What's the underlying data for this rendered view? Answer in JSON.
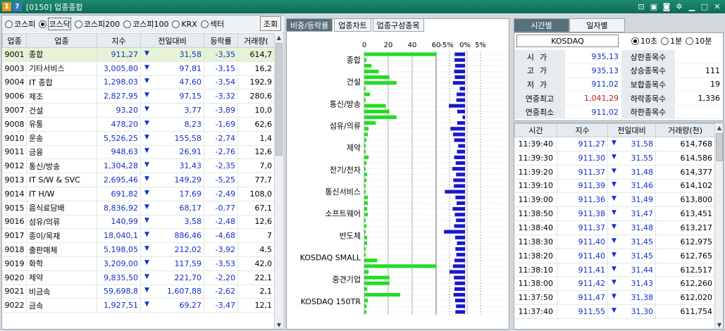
{
  "window": {
    "badge1": "1",
    "badge2": "?",
    "title": "[0150] 업종종합",
    "icons": [
      "pin-icon",
      "window-icon",
      "camera-icon",
      "settings-icon",
      "minimize-icon",
      "maximize-icon",
      "close-icon"
    ]
  },
  "markets": [
    {
      "label": "코스피",
      "selected": false
    },
    {
      "label": "코스닥",
      "selected": true
    },
    {
      "label": "코스피200",
      "selected": false
    },
    {
      "label": "코스피100",
      "selected": false
    },
    {
      "label": "KRX",
      "selected": false
    },
    {
      "label": "섹터",
      "selected": false
    }
  ],
  "search_label": "조회",
  "sector_table": {
    "headers": [
      "업종",
      "업종",
      "지수",
      "전일대비",
      "등락률",
      "거래량("
    ],
    "rows": [
      [
        "9001",
        "종합",
        "911,27",
        "31,58",
        "-3,35",
        "614,7"
      ],
      [
        "9003",
        "기타서비스",
        "3,005,80",
        "97,81",
        "-3,15",
        "16,2"
      ],
      [
        "9004",
        "IT 종합",
        "1,298,03",
        "47,60",
        "-3,54",
        "192,9"
      ],
      [
        "9006",
        "제조",
        "2,827,95",
        "97,15",
        "-3,32",
        "280,6"
      ],
      [
        "9007",
        "건설",
        "93,20",
        "3,77",
        "-3,89",
        "10,0"
      ],
      [
        "9008",
        "유통",
        "478,20",
        "8,23",
        "-1,69",
        "62,6"
      ],
      [
        "9010",
        "운송",
        "5,526,25",
        "155,58",
        "-2,74",
        "1,4"
      ],
      [
        "9011",
        "금융",
        "948,63",
        "26,91",
        "-2,76",
        "12,6"
      ],
      [
        "9012",
        "통신/방송",
        "1,304,28",
        "31,43",
        "-2,35",
        "7,0"
      ],
      [
        "9013",
        "IT S/W & SVC",
        "2,695,46",
        "149,29",
        "-5,25",
        "77,7"
      ],
      [
        "9014",
        "IT H/W",
        "691,82",
        "17,69",
        "-2,49",
        "108,0"
      ],
      [
        "9015",
        "음식료담배",
        "8,836,92",
        "68,17",
        "-0,77",
        "67,1"
      ],
      [
        "9016",
        "섬유/의류",
        "140,99",
        "3,58",
        "-2,48",
        "12,6"
      ],
      [
        "9017",
        "종이/목재",
        "18,040,1",
        "886,46",
        "-4,68",
        "7"
      ],
      [
        "9018",
        "출판매체",
        "5,198,05",
        "212,02",
        "-3,92",
        "4,5"
      ],
      [
        "9019",
        "화학",
        "3,209,00",
        "117,59",
        "-3,53",
        "42,0"
      ],
      [
        "9020",
        "제약",
        "9,835,50",
        "221,70",
        "-2,20",
        "22,1"
      ],
      [
        "9021",
        "비금속",
        "59,698,8",
        "1,607,88",
        "-2,62",
        "2,1"
      ],
      [
        "9022",
        "금속",
        "1,927,51",
        "69,27",
        "-3,47",
        "12,1"
      ]
    ]
  },
  "mid_tabs": [
    "비중/등락률",
    "업종차트",
    "업종구성종목"
  ],
  "chart_data": {
    "type": "bar",
    "title": "",
    "x_ticks_weight": [
      "0",
      "20",
      "40",
      "60"
    ],
    "x_ticks_change": [
      "-5%",
      "0%",
      "5%"
    ],
    "categories": [
      "종합",
      "건설",
      "통신/방송",
      "섬유/의류",
      "제약",
      "전기/전자",
      "통신서비스",
      "소프트웨어",
      "반도체",
      "KOSDAQ SMALL",
      "중견기업",
      "KOSDAQ 150TR"
    ],
    "weight": [
      100,
      3,
      10,
      20,
      35,
      45,
      2,
      8,
      2,
      30,
      35,
      45,
      16,
      6,
      5,
      3,
      2,
      2,
      6,
      3,
      2,
      4,
      3,
      2,
      2,
      5,
      5,
      4,
      5,
      2,
      3,
      2,
      4,
      4,
      2,
      2,
      18,
      100,
      6,
      35,
      35,
      4,
      50,
      5,
      3,
      3
    ],
    "change": [
      -3.35,
      -3.4,
      -3.2,
      -3.5,
      -3.3,
      -3.9,
      -1.7,
      -2.7,
      -2.8,
      -5.2,
      -2.5,
      -0.8,
      -2.5,
      -4.7,
      -3.9,
      -3.5,
      -2.2,
      -2.6,
      -3.5,
      -3.0,
      -4.1,
      -2.9,
      -3.8,
      -3.6,
      -6.5,
      -3.1,
      -2.7,
      -4.0,
      -3.3,
      -2.9,
      -3.5,
      -6.8,
      -3.2,
      -2.6,
      -3.1,
      -2.8,
      -3.4,
      -3.9,
      -5.0,
      -3.6,
      -3.3,
      -3.4,
      -3.7,
      -3.2,
      -2.9,
      -3.1
    ]
  },
  "right_tabs": [
    "시간별",
    "일자별"
  ],
  "index_name": "KOSDAQ",
  "intervals": [
    {
      "label": "10초",
      "selected": true
    },
    {
      "label": "1분",
      "selected": false
    },
    {
      "label": "10분",
      "selected": false
    }
  ],
  "summary": [
    {
      "k1": "시가",
      "v1": "935,13",
      "k2": "상한종목수",
      "v2": ""
    },
    {
      "k1": "고가",
      "v1": "935,13",
      "k2": "상승종목수",
      "v2": "111"
    },
    {
      "k1": "저가",
      "v1": "911,02",
      "k2": "보합종목수",
      "v2": "19"
    },
    {
      "k1": "연중최고",
      "v1": "1,041,29",
      "k2": "하락종목수",
      "v2": "1,336"
    },
    {
      "k1": "연중최소",
      "v1": "911,02",
      "k2": "하한종목수",
      "v2": ""
    }
  ],
  "time_table": {
    "headers": [
      "시간",
      "지수",
      "전일대비",
      "거래량(천)"
    ],
    "rows": [
      [
        "11:39:40",
        "911,27",
        "31,58",
        "614,768"
      ],
      [
        "11:39:30",
        "911,30",
        "31,55",
        "614,586"
      ],
      [
        "11:39:20",
        "911,37",
        "31,48",
        "614,377"
      ],
      [
        "11:39:10",
        "911,39",
        "31,46",
        "614,102"
      ],
      [
        "11:39:00",
        "911,36",
        "31,49",
        "613,800"
      ],
      [
        "11:38:50",
        "911,38",
        "31,47",
        "613,451"
      ],
      [
        "11:38:40",
        "911,37",
        "31,48",
        "613,217"
      ],
      [
        "11:38:30",
        "911,40",
        "31,45",
        "612,975"
      ],
      [
        "11:38:20",
        "911,40",
        "31,45",
        "612,765"
      ],
      [
        "11:38:10",
        "911,41",
        "31,44",
        "612,517"
      ],
      [
        "11:38:00",
        "911,42",
        "31,43",
        "612,260"
      ],
      [
        "11:37:50",
        "911,47",
        "31,38",
        "612,020"
      ],
      [
        "11:37:40",
        "911,55",
        "31,30",
        "611,754"
      ]
    ]
  }
}
